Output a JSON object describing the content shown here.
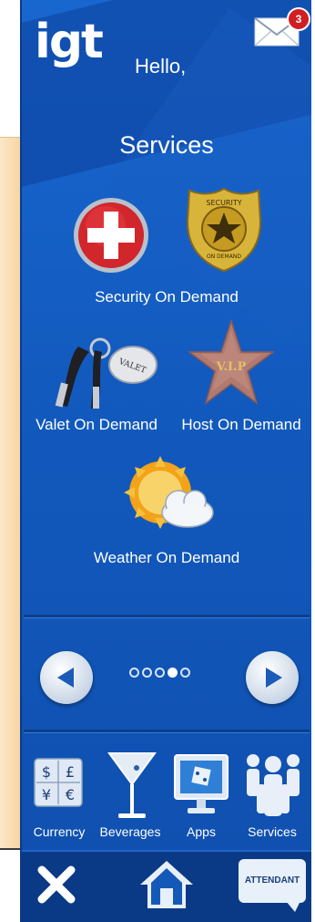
{
  "header": {
    "logo_text": "igt",
    "greeting": "Hello,",
    "mail_count": "3",
    "mail_icon": "envelope-icon"
  },
  "page": {
    "title": "Services"
  },
  "services": [
    {
      "label": "Security On Demand",
      "icons": [
        "red-cross-icon",
        "security-badge-icon"
      ]
    },
    {
      "label": "Valet On Demand",
      "icons": [
        "car-keys-icon"
      ]
    },
    {
      "label": "Host On Demand",
      "icons": [
        "vip-star-icon"
      ]
    },
    {
      "label": "Weather On Demand",
      "icons": [
        "sun-cloud-icon"
      ]
    }
  ],
  "badge_text": {
    "security_top": "SECURITY",
    "security_bottom": "ON DEMAND",
    "valet_tag": "VALET",
    "vip": "V.I.P"
  },
  "pager": {
    "pages": 5,
    "current": 4,
    "prev_icon": "arrow-left-icon",
    "next_icon": "arrow-right-icon"
  },
  "tabs": [
    {
      "label": "Currency",
      "icon": "currency-icon",
      "symbols": [
        "$",
        "£",
        "¥",
        "€"
      ]
    },
    {
      "label": "Beverages",
      "icon": "martini-icon"
    },
    {
      "label": "Apps",
      "icon": "apps-monitor-icon"
    },
    {
      "label": "Services",
      "icon": "people-icon"
    }
  ],
  "bottom_bar": {
    "close_icon": "close-icon",
    "home_icon": "home-icon",
    "attendant_label": "ATTENDANT"
  },
  "colors": {
    "primary_blue": "#1560c6",
    "dark_blue": "#0a3a86",
    "badge_red": "#d01f23",
    "text": "#ffffff"
  }
}
